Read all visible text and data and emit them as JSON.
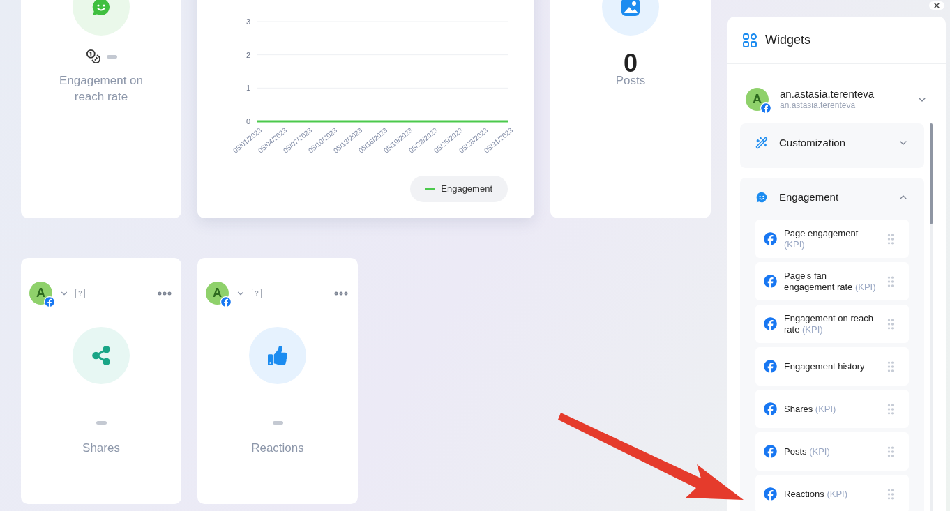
{
  "top_row": [
    {
      "kind": "metric",
      "title": "Engagement on reach rate"
    },
    {
      "kind": "chart",
      "chart_data": {
        "type": "line",
        "categories": [
          "05/01/2023",
          "05/04/2023",
          "05/07/2023",
          "05/10/2023",
          "05/13/2023",
          "05/16/2023",
          "05/19/2023",
          "05/22/2023",
          "05/25/2023",
          "05/28/2023",
          "05/31/2023"
        ],
        "series": [
          {
            "name": "Engagement",
            "color": "#4cc94c",
            "values": [
              0,
              0,
              0,
              0,
              0,
              0,
              0,
              0,
              0,
              0,
              0
            ]
          }
        ],
        "ylim": [
          0,
          3
        ],
        "yticks": [
          0,
          1,
          2,
          3
        ]
      }
    },
    {
      "kind": "metric",
      "value": "0",
      "title": "Posts"
    }
  ],
  "bottom_row": [
    {
      "kind": "metric",
      "avatar": "A",
      "title": "Shares"
    },
    {
      "kind": "metric",
      "avatar": "A",
      "title": "Reactions"
    }
  ],
  "panel": {
    "title": "Widgets",
    "account": {
      "avatar": "A",
      "name": "an.astasia.terenteva",
      "handle": "an.astasia.terenteva",
      "expanded": false
    },
    "sections": [
      {
        "title": "Customization",
        "expanded": false
      },
      {
        "title": "Engagement",
        "expanded": true,
        "items": [
          {
            "name": "Page engagement",
            "tag": "(KPI)"
          },
          {
            "name": "Page's fan engagement rate",
            "tag": "(KPI)"
          },
          {
            "name": "Engagement on reach rate",
            "tag": "(KPI)"
          },
          {
            "name": "Engagement history"
          },
          {
            "name": "Shares",
            "tag": "(KPI)"
          },
          {
            "name": "Posts",
            "tag": "(KPI)"
          },
          {
            "name": "Reactions",
            "tag": "(KPI)"
          }
        ]
      }
    ]
  }
}
